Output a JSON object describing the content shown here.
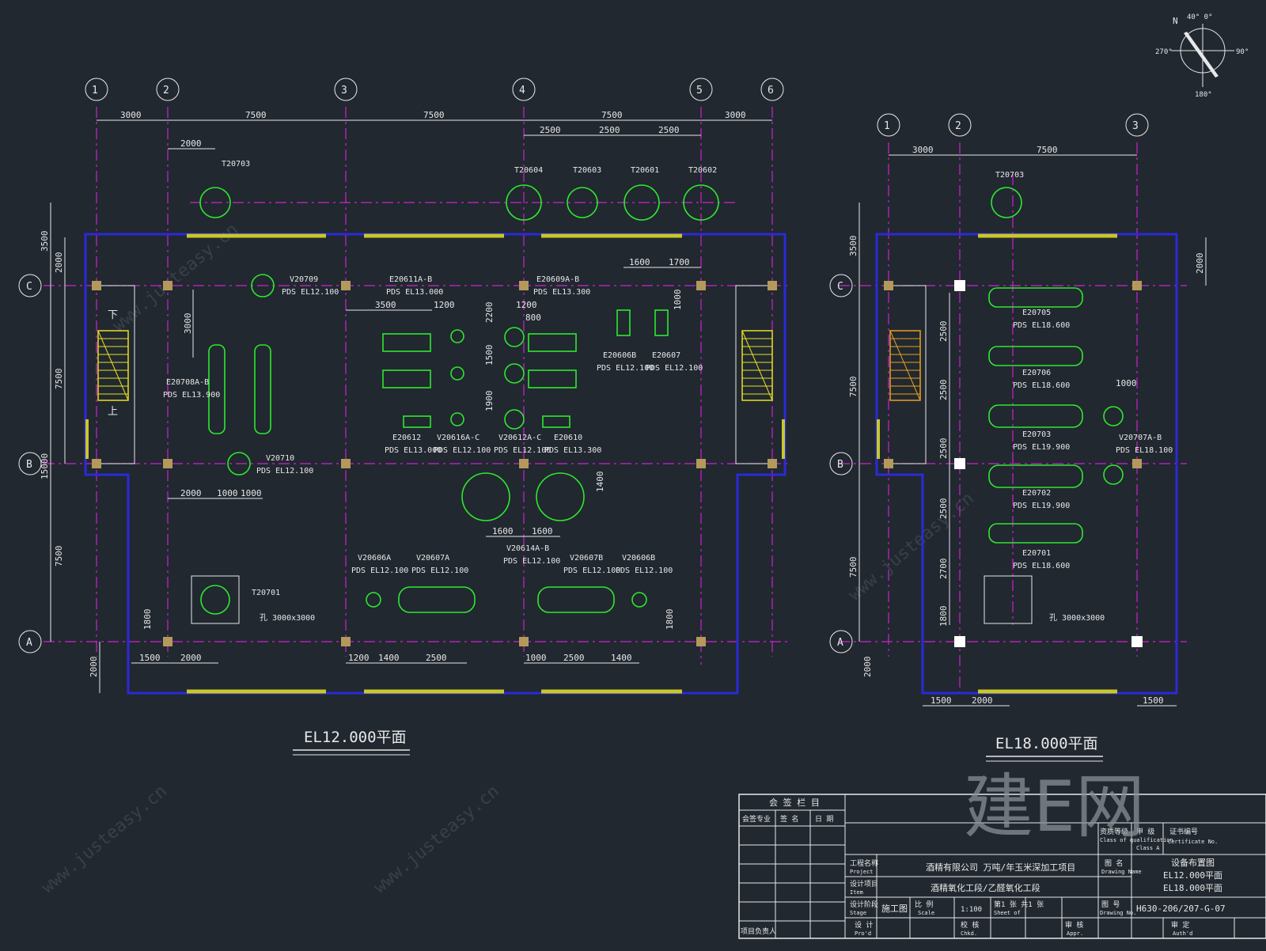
{
  "plan_left": {
    "title": "EL12.000平面",
    "axes": [
      "1",
      "2",
      "3",
      "4",
      "5",
      "6"
    ],
    "rows": [
      "C",
      "B",
      "A"
    ],
    "top_dims": [
      "3000",
      "7500",
      "7500",
      "7500",
      "3000"
    ],
    "top_sub_dims": [
      "2500",
      "2500",
      "2500"
    ],
    "dim_2000_top": "2000",
    "left_dims": [
      "3500",
      "2000",
      "7500",
      "15000",
      "7500"
    ],
    "bottom_dims_left": [
      "1500",
      "2000"
    ],
    "bottom_dims_mid": [
      "1200",
      "1400",
      "2500"
    ],
    "bottom_dims_right": [
      "1000",
      "2500",
      "1400"
    ],
    "bottom_left_vert": "2000",
    "towers": [
      "T20703",
      "T20604",
      "T20603",
      "T20601",
      "T20602"
    ],
    "equipment": [
      {
        "tag": "V20709",
        "el": "PDS EL12.100"
      },
      {
        "tag": "E20611A-B",
        "el": "PDS EL13.000"
      },
      {
        "tag": "E20609A-B",
        "el": "PDS EL13.300"
      },
      {
        "tag": "E20708A-B",
        "el": "PDS EL13.900"
      },
      {
        "tag": "E20606B",
        "el": "PDS EL12.100"
      },
      {
        "tag": "E20607",
        "el": "PDS EL12.100"
      },
      {
        "tag": "E20612",
        "el": "PDS EL13.000"
      },
      {
        "tag": "V20616A-C",
        "el": "PDS EL12.100"
      },
      {
        "tag": "V20612A-C",
        "el": "PDS EL12.100"
      },
      {
        "tag": "E20610",
        "el": "PDS EL13.300"
      },
      {
        "tag": "V20710",
        "el": "PDS EL12.100"
      },
      {
        "tag": "V20614A-B",
        "el": "PDS EL12.100"
      },
      {
        "tag": "V20606A",
        "el": "PDS EL12.100"
      },
      {
        "tag": "V20607A",
        "el": "PDS EL12.100"
      },
      {
        "tag": "V20607B",
        "el": "PDS EL12.100"
      },
      {
        "tag": "V20606B",
        "el": "PDS EL12.100"
      },
      {
        "tag": "T20701",
        "el": ""
      }
    ],
    "inner_dims": [
      "3000",
      "3500",
      "1200",
      "2200",
      "1200",
      "800",
      "1500",
      "1900",
      "1600",
      "1700",
      "1000",
      "2000",
      "1000",
      "1000",
      "1600",
      "1600",
      "1400",
      "1800",
      "1800"
    ],
    "opening_label": "孔 3000x3000",
    "stair_down": "下",
    "stair_up": "上"
  },
  "plan_right": {
    "title": "EL18.000平面",
    "axes": [
      "1",
      "2",
      "3"
    ],
    "rows": [
      "C",
      "B",
      "A"
    ],
    "top_dims": [
      "3000",
      "7500"
    ],
    "left_dims": [
      "3500",
      "7500",
      "7500",
      "2000"
    ],
    "right_dim": "2000",
    "vert_dims": [
      "2500",
      "2500",
      "2500",
      "2500",
      "2700",
      "1800"
    ],
    "bottom_dims": [
      "1500",
      "2000",
      "1500"
    ],
    "tower": "T20703",
    "equipment": [
      {
        "tag": "E20705",
        "el": "PDS EL18.600"
      },
      {
        "tag": "E20706",
        "el": "PDS EL18.600"
      },
      {
        "tag": "E20703",
        "el": "PDS EL19.900"
      },
      {
        "tag": "E20702",
        "el": "PDS EL19.900"
      },
      {
        "tag": "E20701",
        "el": "PDS EL18.600"
      },
      {
        "tag": "V20707A-B",
        "el": "PDS EL18.100"
      }
    ],
    "dim_1000": "1000",
    "opening_label": "孔 3000x3000"
  },
  "compass": {
    "n": "N",
    "a0": "40° 0°",
    "e": "90°",
    "w": "270°",
    "s": "180°"
  },
  "title_block": {
    "countersign": "会 签 栏 目",
    "cs_cols": [
      "会签专业",
      "签 名",
      "日 期"
    ],
    "qual_label": "资质等级",
    "qual_label_en": "Class of qualification",
    "qual_value": "甲 级",
    "qual_value_en": "Class A",
    "cert_label": "证书编号",
    "cert_label_en": "Certificate No.",
    "project_label": "工程名称",
    "project_label_en": "Project",
    "project_value": "酒精有限公司    万吨/年玉米深加工项目",
    "drawing_name_label": "图 名",
    "drawing_name_label_en": "Drawing Name",
    "drawing_name_1": "设备布置图",
    "drawing_name_2": "EL12.000平面",
    "drawing_name_3": "EL18.000平面",
    "item_label": "设计项目",
    "item_label_en": "Item",
    "item_value": "酒精氧化工段/乙醛氧化工段",
    "stage_label": "设计阶段",
    "stage_label_en": "Stage",
    "stage_value": "施工图",
    "scale_label": "比 例",
    "scale_label_en": "Scale",
    "scale_value": "1:100",
    "sheet_label": "第1 张 共1 张",
    "sheet_label_en": "Sheet of",
    "drawing_no_label": "图 号",
    "drawing_no_label_en": "Drawing No.",
    "drawing_no": "H630-206/207-G-07",
    "design_label": "设 计",
    "design_label_en": "Pro'd",
    "check_label": "校 核",
    "check_label_en": "Chkd.",
    "review_label": "审 核",
    "review_label_en": "Appr.",
    "approve_label": "审 定",
    "approve_label_en": "Auth'd",
    "pm_label": "项目负责人"
  },
  "watermark": {
    "logo": "建E网",
    "site": "www.justeasy.cn"
  }
}
